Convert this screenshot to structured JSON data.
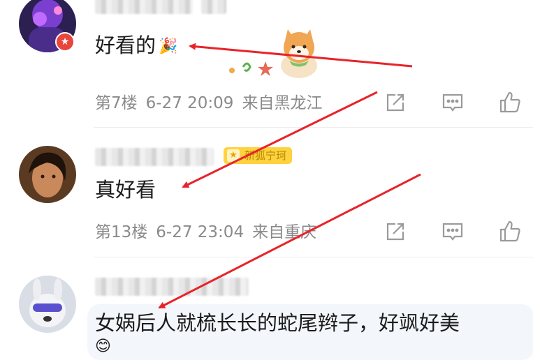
{
  "comments": [
    {
      "content": "好看的",
      "floor": "第7楼",
      "time": "6-27 20:09",
      "location": "来自黑龙江"
    },
    {
      "badge": "新狐宁珂",
      "content": "真好看",
      "floor": "第13楼",
      "time": "6-27 23:04",
      "location": "来自重庆"
    },
    {
      "content": "女娲后人就梳长长的蛇尾辫子，好飒好美"
    }
  ],
  "icons": {
    "share": "share-icon",
    "reply": "comment-icon",
    "like": "thumbs-up-icon"
  },
  "colors": {
    "annotation_arrow": "#e8232a",
    "badge": "#ffd23f",
    "meta_text": "#8a8a8a"
  }
}
